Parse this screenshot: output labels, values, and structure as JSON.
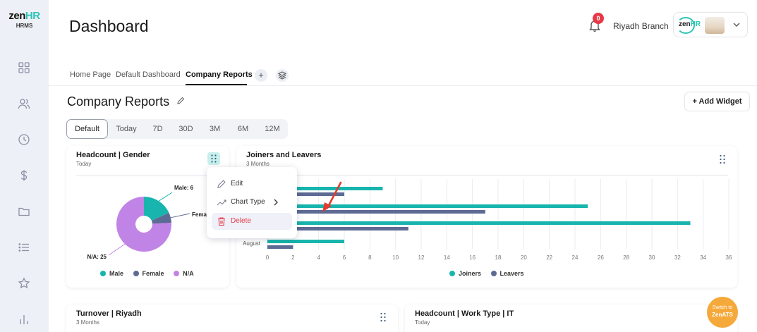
{
  "brand": {
    "logo_text": "zen",
    "logo_hr": "HR",
    "product": "HRMS"
  },
  "header": {
    "title": "Dashboard",
    "notification_count": "0",
    "branch": "Riyadh Branch",
    "user_logo_text": "zen",
    "user_logo_hr": "HR"
  },
  "tabs": [
    {
      "label": "Home Page"
    },
    {
      "label": "Default Dashboard"
    },
    {
      "label": "Company Reports"
    }
  ],
  "section": {
    "title": "Company Reports",
    "add_widget_label": "+  Add Widget"
  },
  "ranges": [
    {
      "label": "Default",
      "active": true
    },
    {
      "label": "Today"
    },
    {
      "label": "7D"
    },
    {
      "label": "30D"
    },
    {
      "label": "3M"
    },
    {
      "label": "6M"
    },
    {
      "label": "12M"
    }
  ],
  "widgets": {
    "headcount_gender": {
      "title": "Headcount | Gender",
      "subtitle": "Today"
    },
    "joiners_leavers": {
      "title": "Joiners and Leavers",
      "subtitle": "3 Months"
    },
    "turnover": {
      "title": "Turnover | Riyadh",
      "subtitle": "3 Months"
    },
    "work_type": {
      "title": "Headcount | Work Type | IT",
      "subtitle": "Today"
    }
  },
  "context_menu": {
    "edit": "Edit",
    "chart_type": "Chart Type",
    "delete": "Delete"
  },
  "switch": {
    "line1": "Switch to",
    "line2": "ZenATS"
  },
  "colors": {
    "teal": "#17b5ad",
    "slate": "#5d6b94",
    "purple": "#c084e6",
    "danger": "#e53946",
    "accent": "#2ec4b6"
  },
  "chart_data": [
    {
      "type": "pie",
      "title": "Headcount | Gender",
      "series": [
        {
          "name": "Male",
          "value": 6
        },
        {
          "name": "Female",
          "value": 2
        },
        {
          "name": "N/A",
          "value": 25
        }
      ],
      "data_labels": [
        "Male: 6",
        "Fema",
        "N/A: 25"
      ],
      "legend": [
        "Male",
        "Female",
        "N/A"
      ],
      "legend_position": "bottom"
    },
    {
      "type": "bar",
      "orientation": "horizontal",
      "title": "Joiners and Leavers",
      "categories": [
        "",
        "",
        "",
        "August"
      ],
      "series": [
        {
          "name": "Joiners",
          "values": [
            9,
            25,
            33,
            6
          ]
        },
        {
          "name": "Leavers",
          "values": [
            6,
            17,
            11,
            2
          ]
        }
      ],
      "xticks": [
        "0",
        "2",
        "4",
        "6",
        "8",
        "10",
        "12",
        "14",
        "16",
        "18",
        "20",
        "22",
        "24",
        "26",
        "28",
        "30",
        "32",
        "34",
        "36"
      ],
      "xlim": [
        0,
        36
      ],
      "grid": true,
      "legend_position": "bottom"
    }
  ]
}
